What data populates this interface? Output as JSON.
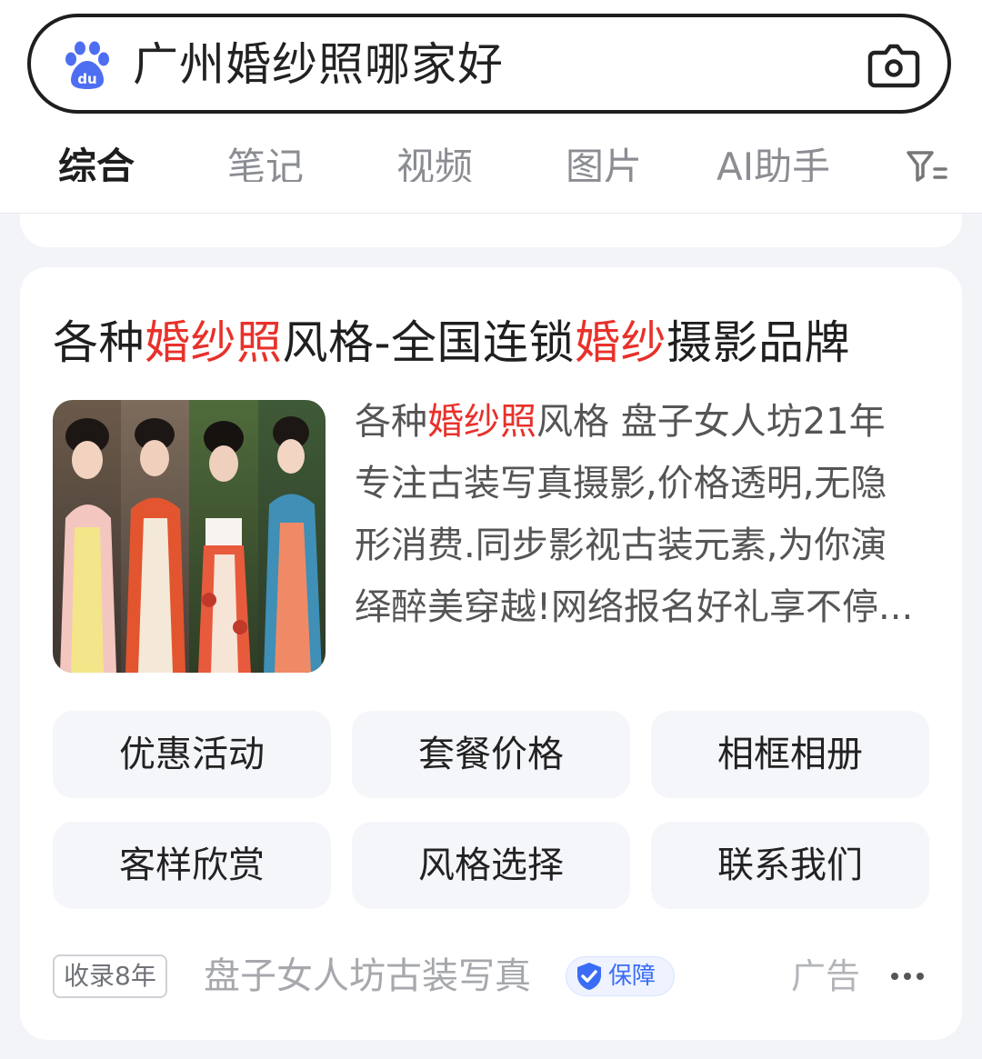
{
  "search": {
    "query": "广州婚纱照哪家好",
    "logo_icon": "baidu-paw-logo",
    "camera_icon": "camera-icon"
  },
  "tabs": [
    {
      "label": "综合",
      "active": true
    },
    {
      "label": "笔记",
      "active": false
    },
    {
      "label": "视频",
      "active": false
    },
    {
      "label": "图片",
      "active": false
    },
    {
      "label": "AI助手",
      "active": false
    }
  ],
  "filter_icon": "filter-icon",
  "result": {
    "title_parts": [
      {
        "text": "各种",
        "highlight": false
      },
      {
        "text": "婚纱照",
        "highlight": true
      },
      {
        "text": "风格-全国连锁",
        "highlight": false
      },
      {
        "text": "婚纱",
        "highlight": true
      },
      {
        "text": "摄影品牌",
        "highlight": false
      }
    ],
    "description": {
      "line1_a": "各种",
      "line1_hl": "婚纱照",
      "line1_b": "风格 盘子女人坊21年",
      "line2": "专注古装写真摄影,价格透明,无隐",
      "line3": "形消费.同步影视古装元素,为你演",
      "line4": "绎醉美穿越!网络报名好礼享不停..."
    },
    "thumbnail": "hanfu-portrait-collage",
    "links": [
      "优惠活动",
      "套餐价格",
      "相框相册",
      "客样欣赏",
      "风格选择",
      "联系我们"
    ],
    "footer": {
      "indexed_badge": "收录8年",
      "source": "盘子女人坊古装写真",
      "guarantee": "保障",
      "ad_label": "广告",
      "more_icon": "more-dots-icon"
    }
  },
  "colors": {
    "highlight": "#e8312b",
    "accent": "#4e6ef2",
    "page_bg": "#f3f4f8"
  }
}
